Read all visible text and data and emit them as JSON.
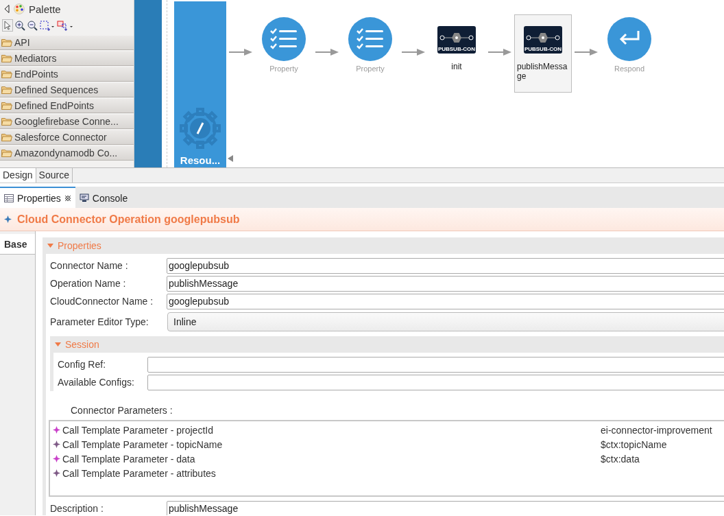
{
  "palette": {
    "title": "Palette",
    "items": [
      {
        "label": "API"
      },
      {
        "label": "Mediators"
      },
      {
        "label": "EndPoints"
      },
      {
        "label": "Defined Sequences"
      },
      {
        "label": "Defined EndPoints"
      },
      {
        "label": "Googlefirebase Conne..."
      },
      {
        "label": "Salesforce Connector"
      },
      {
        "label": "Amazondynamodb Co..."
      }
    ]
  },
  "canvas": {
    "resource_label": "Resou...",
    "nodes": [
      {
        "kind": "property",
        "label": "Property",
        "selected": false
      },
      {
        "kind": "property",
        "label": "Property",
        "selected": false
      },
      {
        "kind": "connector",
        "badge": "PUBSUB-CON",
        "label": "init",
        "selected": false
      },
      {
        "kind": "connector",
        "badge": "PUBSUB-CON",
        "label": "publishMessage",
        "selected": true
      },
      {
        "kind": "respond",
        "label": "Respond",
        "selected": false
      }
    ]
  },
  "editor_tabs": [
    {
      "label": "Design",
      "selected": true
    },
    {
      "label": "Source",
      "selected": false
    }
  ],
  "view_tabs": [
    {
      "label": "Properties",
      "kind": "properties",
      "selected": true,
      "closable": true
    },
    {
      "label": "Console",
      "kind": "console",
      "selected": false,
      "closable": false
    }
  ],
  "title": "Cloud Connector Operation googlepubsub",
  "side_tabs": [
    {
      "label": "Base",
      "selected": true
    }
  ],
  "properties": {
    "header": "Properties",
    "expanded": true,
    "fields": [
      {
        "label": "Connector Name :",
        "value": "googlepubsub"
      },
      {
        "label": "Operation Name :",
        "value": "publishMessage"
      },
      {
        "label": "CloudConnector Name :",
        "value": "googlepubsub"
      }
    ],
    "editor_type": {
      "label": "Parameter Editor Type:",
      "value": "Inline"
    },
    "session": {
      "header": "Session",
      "expanded": true,
      "fields": [
        {
          "label": "Config Ref:"
        },
        {
          "label": "Available Configs:"
        }
      ]
    },
    "parameters_label": "Connector Parameters :",
    "parameters": [
      {
        "name": "Call Template Parameter  -  projectId",
        "value": "ei-connector-improvement",
        "color": "#c93fc9"
      },
      {
        "name": "Call Template Parameter  -  topicName",
        "value": "$ctx:topicName",
        "color": "#7e5a86"
      },
      {
        "name": "Call Template Parameter  -  data",
        "value": "$ctx:data",
        "color": "#c93fc9"
      },
      {
        "name": "Call Template Parameter  -  attributes",
        "color": "#7e5a86"
      }
    ],
    "description": {
      "label": "Description :",
      "value": "publishMessage"
    }
  }
}
